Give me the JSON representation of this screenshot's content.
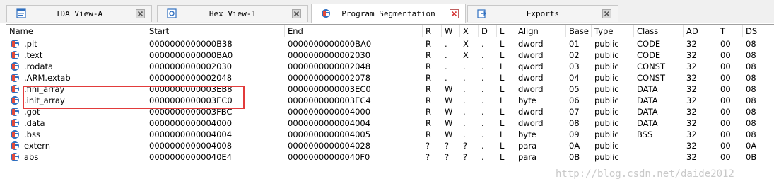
{
  "tabs": [
    {
      "label": "IDA View-A",
      "icon": "ida-view-icon"
    },
    {
      "label": "Hex View-1",
      "icon": "hex-view-icon"
    },
    {
      "label": "Program Segmentation",
      "icon": "segment-icon"
    },
    {
      "label": "Exports",
      "icon": "exports-icon"
    }
  ],
  "columns": [
    "Name",
    "Start",
    "End",
    "R",
    "W",
    "X",
    "D",
    "L",
    "Align",
    "Base",
    "Type",
    "Class",
    "AD",
    "T",
    "DS"
  ],
  "rows": [
    [
      ".plt",
      "0000000000000B38",
      "0000000000000BA0",
      "R",
      ".",
      "X",
      ".",
      "L",
      "dword",
      "01",
      "public",
      "CODE",
      "32",
      "00",
      "08"
    ],
    [
      ".text",
      "0000000000000BA0",
      "0000000000002030",
      "R",
      ".",
      "X",
      ".",
      "L",
      "dword",
      "02",
      "public",
      "CODE",
      "32",
      "00",
      "08"
    ],
    [
      ".rodata",
      "0000000000002030",
      "0000000000002048",
      "R",
      ".",
      ".",
      ".",
      "L",
      "qword",
      "03",
      "public",
      "CONST",
      "32",
      "00",
      "08"
    ],
    [
      ".ARM.extab",
      "0000000000002048",
      "0000000000002078",
      "R",
      ".",
      ".",
      ".",
      "L",
      "dword",
      "04",
      "public",
      "CONST",
      "32",
      "00",
      "08"
    ],
    [
      ".fini_array",
      "0000000000003EB8",
      "0000000000003EC0",
      "R",
      "W",
      ".",
      ".",
      "L",
      "dword",
      "05",
      "public",
      "DATA",
      "32",
      "00",
      "08"
    ],
    [
      ".init_array",
      "0000000000003EC0",
      "0000000000003EC4",
      "R",
      "W",
      ".",
      ".",
      "L",
      "byte",
      "06",
      "public",
      "DATA",
      "32",
      "00",
      "08"
    ],
    [
      ".got",
      "0000000000003FBC",
      "0000000000004000",
      "R",
      "W",
      ".",
      ".",
      "L",
      "dword",
      "07",
      "public",
      "DATA",
      "32",
      "00",
      "08"
    ],
    [
      ".data",
      "0000000000004000",
      "0000000000004004",
      "R",
      "W",
      ".",
      ".",
      "L",
      "dword",
      "08",
      "public",
      "DATA",
      "32",
      "00",
      "08"
    ],
    [
      ".bss",
      "0000000000004004",
      "0000000000004005",
      "R",
      "W",
      ".",
      ".",
      "L",
      "byte",
      "09",
      "public",
      "BSS",
      "32",
      "00",
      "08"
    ],
    [
      "extern",
      "0000000000004008",
      "0000000000004028",
      "?",
      "?",
      "?",
      ".",
      "L",
      "para",
      "0A",
      "public",
      "",
      "32",
      "00",
      "0A"
    ],
    [
      "abs",
      "00000000000040E4",
      "00000000000040F0",
      "?",
      "?",
      "?",
      ".",
      "L",
      "para",
      "0B",
      "public",
      "",
      "32",
      "00",
      "0B"
    ]
  ],
  "watermark": "http://blog.csdn.net/daide2012",
  "colors": {
    "highlight": "#e23b3b",
    "active_close": "#d83b3b"
  }
}
